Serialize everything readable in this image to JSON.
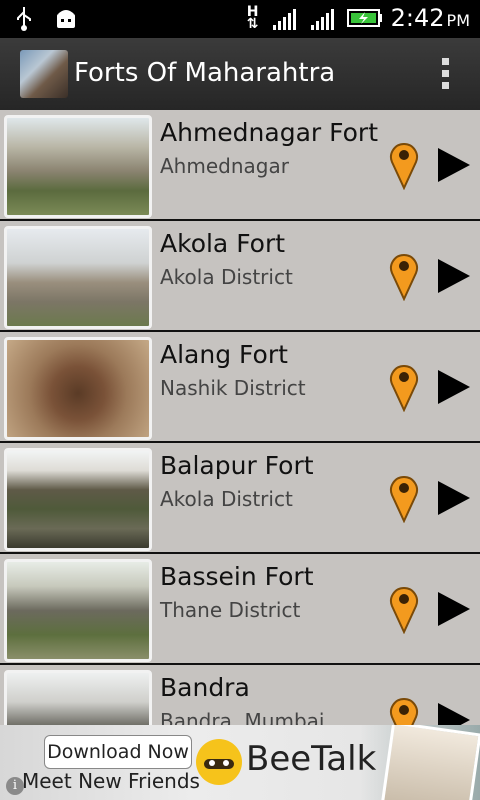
{
  "statusbar": {
    "icons": [
      "usb-icon",
      "android-debug-icon",
      "data-transfer-icon",
      "signal-icon",
      "signal2-icon",
      "battery-charging-icon"
    ],
    "network_type": "H",
    "time": "2:42",
    "ampm": "PM"
  },
  "actionbar": {
    "title": "Forts Of Maharahtra",
    "overflow_icon": "overflow-menu-icon"
  },
  "forts": [
    {
      "name": "Ahmednagar Fort",
      "location": "Ahmednagar"
    },
    {
      "name": "Akola Fort",
      "location": "Akola District"
    },
    {
      "name": "Alang Fort",
      "location": "Nashik District"
    },
    {
      "name": "Balapur Fort",
      "location": "Akola District"
    },
    {
      "name": "Bassein Fort",
      "location": "Thane District"
    },
    {
      "name": "Bandra",
      "location": "Bandra, Mumbai"
    }
  ],
  "row_icons": {
    "map": "map-pin-icon",
    "go": "play-arrow-icon"
  },
  "ad": {
    "button": "Download Now",
    "tagline": "Meet New Friends",
    "brand": "BeeTalk",
    "info": "i"
  },
  "colors": {
    "pin": "#f39a1e",
    "row_bg": "#c6c3c0",
    "actionbar": "#2f2f2f"
  }
}
